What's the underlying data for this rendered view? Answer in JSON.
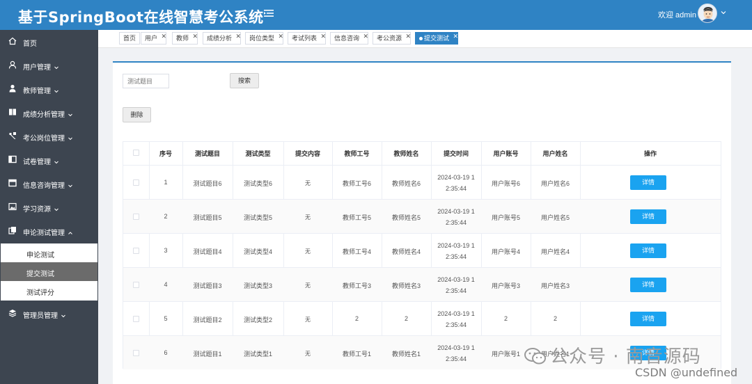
{
  "header": {
    "title": "基于SpringBoot在线智慧考公系统",
    "welcome": "欢迎 admin"
  },
  "sidebar": {
    "items": [
      {
        "label": "首页",
        "icon": "home-icon",
        "has_children": false
      },
      {
        "label": "用户管理",
        "icon": "user-icon",
        "has_children": true
      },
      {
        "label": "教师管理",
        "icon": "person-icon",
        "has_children": true
      },
      {
        "label": "成绩分析管理",
        "icon": "book-icon",
        "has_children": true
      },
      {
        "label": "考公岗位管理",
        "icon": "tools-icon",
        "has_children": true
      },
      {
        "label": "试卷管理",
        "icon": "paper-icon",
        "has_children": true
      },
      {
        "label": "信息咨询管理",
        "icon": "window-icon",
        "has_children": true
      },
      {
        "label": "学习资源",
        "icon": "picture-icon",
        "has_children": true
      },
      {
        "label": "申论测试管理",
        "icon": "copy-icon",
        "has_children": true,
        "expanded": true
      },
      {
        "label": "管理员管理",
        "icon": "stack-icon",
        "has_children": true
      }
    ],
    "submenu": [
      {
        "label": "申论测试",
        "active": false
      },
      {
        "label": "提交测试",
        "active": true
      },
      {
        "label": "测试评分",
        "active": false
      }
    ]
  },
  "tabs": [
    {
      "label": "首页",
      "closable": false
    },
    {
      "label": "用户",
      "closable": true
    },
    {
      "label": "教师",
      "closable": true
    },
    {
      "label": "成绩分析",
      "closable": true
    },
    {
      "label": "岗位类型",
      "closable": true
    },
    {
      "label": "考试列表",
      "closable": true
    },
    {
      "label": "信息咨询",
      "closable": true
    },
    {
      "label": "考公资源",
      "closable": true
    },
    {
      "label": "提交测试",
      "closable": true,
      "active": true
    }
  ],
  "toolbar": {
    "search_placeholder": "测试题目",
    "search_label": "搜索",
    "delete_label": "删除"
  },
  "table": {
    "columns": [
      "序号",
      "测试题目",
      "测试类型",
      "提交内容",
      "教师工号",
      "教师姓名",
      "提交时间",
      "用户账号",
      "用户姓名",
      "操作"
    ],
    "rows": [
      {
        "index": "1",
        "title": "测试题目6",
        "type": "测试类型6",
        "content": "无",
        "teacher_id": "教师工号6",
        "teacher_name": "教师姓名6",
        "time_line1": "2024-03-19 1",
        "time_line2": "2:35:44",
        "account": "用户账号6",
        "user_name": "用户姓名6",
        "action": "详情"
      },
      {
        "index": "2",
        "title": "测试题目5",
        "type": "测试类型5",
        "content": "无",
        "teacher_id": "教师工号5",
        "teacher_name": "教师姓名5",
        "time_line1": "2024-03-19 1",
        "time_line2": "2:35:44",
        "account": "用户账号5",
        "user_name": "用户姓名5",
        "action": "详情"
      },
      {
        "index": "3",
        "title": "测试题目4",
        "type": "测试类型4",
        "content": "无",
        "teacher_id": "教师工号4",
        "teacher_name": "教师姓名4",
        "time_line1": "2024-03-19 1",
        "time_line2": "2:35:44",
        "account": "用户账号4",
        "user_name": "用户姓名4",
        "action": "详情"
      },
      {
        "index": "4",
        "title": "测试题目3",
        "type": "测试类型3",
        "content": "无",
        "teacher_id": "教师工号3",
        "teacher_name": "教师姓名3",
        "time_line1": "2024-03-19 1",
        "time_line2": "2:35:44",
        "account": "用户账号3",
        "user_name": "用户姓名3",
        "action": "详情"
      },
      {
        "index": "5",
        "title": "测试题目2",
        "type": "测试类型2",
        "content": "无",
        "teacher_id": "2",
        "teacher_name": "2",
        "time_line1": "2024-03-19 1",
        "time_line2": "2:35:44",
        "account": "2",
        "user_name": "2",
        "action": "详情"
      },
      {
        "index": "6",
        "title": "测试题目1",
        "type": "测试类型1",
        "content": "无",
        "teacher_id": "教师工号1",
        "teacher_name": "教师姓名1",
        "time_line1": "2024-03-19 1",
        "time_line2": "2:35:44",
        "account": "用户账号1",
        "user_name": "用户姓名1",
        "action": "详情"
      }
    ]
  },
  "watermark": {
    "wechat": "公众号 · 南音源码",
    "csdn": "CSDN @undefined"
  },
  "colors": {
    "header": "#2f83c4",
    "sidebar": "#3d4550",
    "detail_button": "#1aa3f0",
    "active_tab": "#2f83c4"
  }
}
